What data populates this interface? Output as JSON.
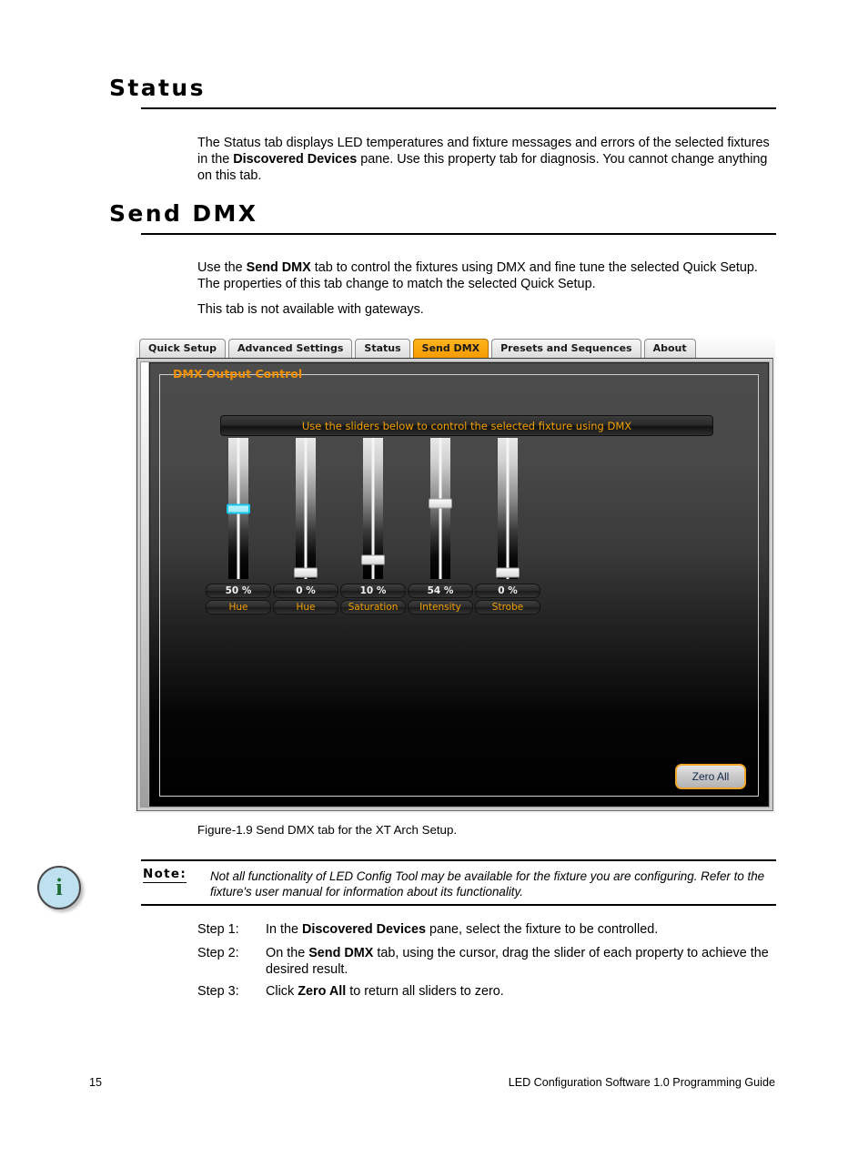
{
  "sections": [
    {
      "heading": "Status",
      "paragraph_html": "The Status tab displays LED temperatures and fixture messages and errors of the selected fixtures in the <b>Discovered Devices</b> pane. Use this property tab for diagnosis. You cannot change anything on this tab."
    },
    {
      "heading": "Send DMX",
      "paragraph_html": "Use the <b>Send DMX</b> tab to control the fixtures using DMX and fine tune the selected Quick Setup. The properties of this tab change to match the selected Quick Setup.",
      "paragraph2": "This tab is not available with gateways."
    }
  ],
  "app": {
    "tabs": [
      {
        "label": "Quick Setup",
        "active": false
      },
      {
        "label": "Advanced Settings",
        "active": false
      },
      {
        "label": "Status",
        "active": false
      },
      {
        "label": "Send DMX",
        "active": true
      },
      {
        "label": "Presets and Sequences",
        "active": false
      },
      {
        "label": "About",
        "active": false
      }
    ],
    "groupbox_title": "DMX Output Control",
    "instruction": "Use the sliders below to control the selected fixture using DMX",
    "zero_all_label": "Zero All",
    "accent_orange": "#f0a000",
    "selected_thumb_color": "#16c6ec",
    "sliders": [
      {
        "value_label": "50 %",
        "name_label": "Hue",
        "percent": 50,
        "selected": true
      },
      {
        "value_label": "0 %",
        "name_label": "Hue",
        "percent": 0,
        "selected": false
      },
      {
        "value_label": "10 %",
        "name_label": "Saturation",
        "percent": 10,
        "selected": false
      },
      {
        "value_label": "54 %",
        "name_label": "Intensity",
        "percent": 54,
        "selected": false
      },
      {
        "value_label": "0 %",
        "name_label": "Strobe",
        "percent": 0,
        "selected": false
      }
    ]
  },
  "figure_caption": "Figure-1.9 Send DMX tab for the XT Arch Setup.",
  "note": {
    "label": "Note:",
    "icon": "info-icon",
    "text": "Not all functionality of LED Config Tool may be available for the fixture you are configuring. Refer to the fixture's user manual for information about its functionality."
  },
  "steps": [
    {
      "label": "Step 1:",
      "html": "In the <b>Discovered Devices</b> pane, select the fixture to be controlled."
    },
    {
      "label": "Step 2:",
      "html": "On the <b>Send DMX</b> tab, using the cursor, drag the slider of each property to achieve the desired result."
    },
    {
      "label": "Step 3:",
      "html": "Click <b>Zero All</b> to return all sliders to zero."
    }
  ],
  "footer": {
    "page_number": "15",
    "title": "LED Configuration Software 1.0 Programming Guide"
  }
}
